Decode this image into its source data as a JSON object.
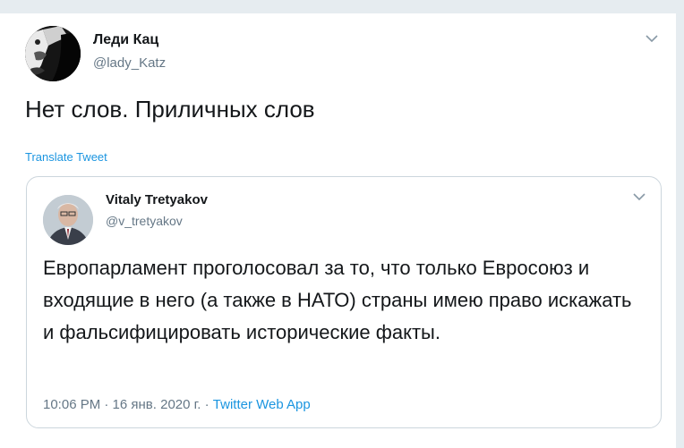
{
  "tweet": {
    "author_name": "Леди Кац",
    "author_handle": "@lady_Katz",
    "text": "Нет слов. Приличных слов",
    "translate_label": "Translate Tweet"
  },
  "quoted_tweet": {
    "author_name": "Vitaly Tretyakov",
    "author_handle": "@v_tretyakov",
    "text": "Европарламент проголосовал за то, что только Евросоюз и входящие в него (а также в НАТО) страны имею право искажать и фальсифицировать исторические факты.",
    "timestamp": "10:06 PM · 16 янв. 2020 г. · ",
    "app": "Twitter Web App"
  },
  "colors": {
    "link": "#1b95e0",
    "secondary_text": "#657786",
    "primary_text": "#14171a",
    "border": "#ccd6dd"
  },
  "icons": {
    "caret": "chevron-down-icon"
  }
}
